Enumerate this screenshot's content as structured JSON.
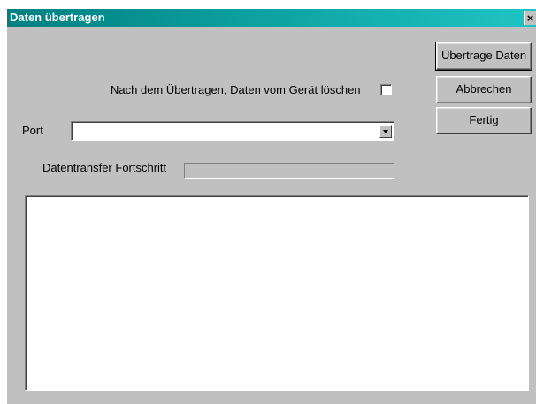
{
  "window": {
    "title": "Daten übertragen",
    "close_label": "×"
  },
  "buttons": {
    "transfer_label": "Übertrage Daten",
    "cancel_label": "Abbrechen",
    "done_label": "Fertig"
  },
  "options": {
    "delete_after_transfer_label": "Nach dem Übertragen, Daten vom Gerät löschen",
    "delete_after_transfer_checked": false
  },
  "port": {
    "label": "Port",
    "selected_value": ""
  },
  "progress": {
    "label": "Datentransfer Fortschritt",
    "value_fraction": 0
  },
  "log": {
    "content": ""
  },
  "icons": {
    "close": "close-icon",
    "dropdown": "chevron-down-icon"
  },
  "colors": {
    "titlebar_start": "#008080",
    "titlebar_end": "#20c4c4",
    "face": "#c0c0c0"
  }
}
